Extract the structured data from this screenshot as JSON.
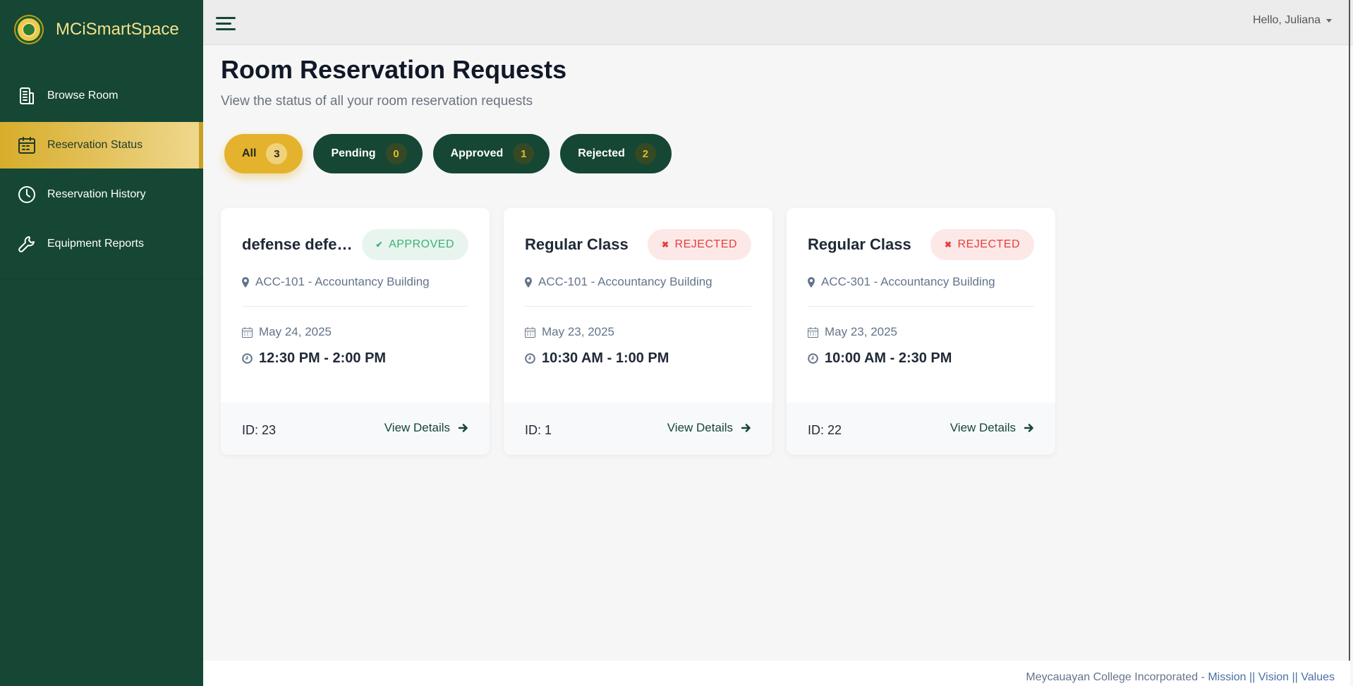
{
  "brand": {
    "name": "MCiSmartSpace"
  },
  "sidebar": {
    "items": [
      {
        "label": "Browse Room",
        "icon": "building-icon",
        "active": false
      },
      {
        "label": "Reservation Status",
        "icon": "calendar-icon",
        "active": true
      },
      {
        "label": "Reservation History",
        "icon": "clock-icon",
        "active": false
      },
      {
        "label": "Equipment Reports",
        "icon": "wrench-icon",
        "active": false
      }
    ]
  },
  "topbar": {
    "greeting": "Hello, Juliana"
  },
  "page": {
    "title": "Room Reservation Requests",
    "subtitle": "View the status of all your room reservation requests"
  },
  "filters": [
    {
      "label": "All",
      "count": "3",
      "active": true
    },
    {
      "label": "Pending",
      "count": "0",
      "active": false
    },
    {
      "label": "Approved",
      "count": "1",
      "active": false
    },
    {
      "label": "Rejected",
      "count": "2",
      "active": false
    }
  ],
  "cards": [
    {
      "title": "defense defense",
      "status": "APPROVED",
      "location": "ACC-101 - Accountancy Building",
      "date": "May 24, 2025",
      "time": "12:30 PM - 2:00 PM",
      "id": "ID: 23",
      "link": "View Details"
    },
    {
      "title": "Regular Class",
      "status": "REJECTED",
      "location": "ACC-101 - Accountancy Building",
      "date": "May 23, 2025",
      "time": "10:30 AM - 1:00 PM",
      "id": "ID: 1",
      "link": "View Details"
    },
    {
      "title": "Regular Class",
      "status": "REJECTED",
      "location": "ACC-301 - Accountancy Building",
      "date": "May 23, 2025",
      "time": "10:00 AM - 2:30 PM",
      "id": "ID: 22",
      "link": "View Details"
    }
  ],
  "footer": {
    "org": "Meycauayan College Incorporated - ",
    "mission": "Mission",
    "sep1": " || ",
    "vision": "Vision",
    "sep2": " || ",
    "values": "Values"
  },
  "colors": {
    "sidebar": "#154734",
    "accent": "#e5b22d",
    "approved": "#3bb273",
    "rejected": "#e53e3e"
  }
}
